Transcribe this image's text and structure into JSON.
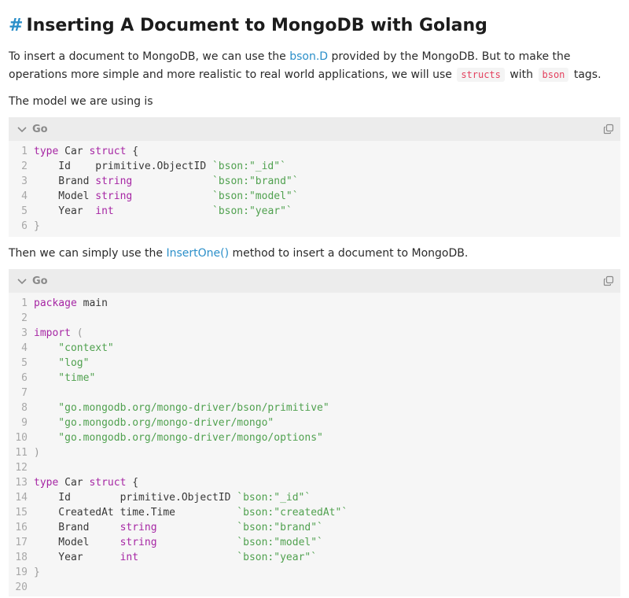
{
  "heading": {
    "hash": "#",
    "text": "Inserting A Document to MongoDB with Golang"
  },
  "intro": {
    "line1_a": "To insert a document to MongoDB, we can use the ",
    "line1_link": "bson.D",
    "line1_b": " provided by the MongoDB. But to make the",
    "line2_a": "operations more simple and more realistic to real world applications, we will use ",
    "code1": "structs",
    "line2_b": " with ",
    "code2": "bson",
    "line2_c": " tags."
  },
  "model_text": "The model we are using is",
  "block1": {
    "lang": "Go",
    "lines": [
      [
        [
          "kw",
          "type"
        ],
        [
          "",
          "Car "
        ],
        [
          "kw",
          "struct"
        ],
        [
          "",
          "{"
        ]
      ],
      [
        [
          "",
          "    Id    primitive.ObjectID "
        ],
        [
          "str",
          "`bson:\"_id\"`"
        ]
      ],
      [
        [
          "",
          "    Brand "
        ],
        [
          "kw",
          "string"
        ],
        [
          "",
          "             "
        ],
        [
          "str",
          "`bson:\"brand\"`"
        ]
      ],
      [
        [
          "",
          "    Model "
        ],
        [
          "kw",
          "string"
        ],
        [
          "",
          "             "
        ],
        [
          "str",
          "`bson:\"model\"`"
        ]
      ],
      [
        [
          "",
          "    Year  "
        ],
        [
          "kw",
          "int"
        ],
        [
          "",
          "                "
        ],
        [
          "str",
          "`bson:\"year\"`"
        ]
      ],
      [
        [
          "pn",
          "}"
        ]
      ]
    ]
  },
  "then_text": {
    "a": "Then we can simply use the ",
    "link": "InsertOne()",
    "b": " method to insert a document to MongoDB."
  },
  "block2": {
    "lang": "Go",
    "lines": [
      [
        [
          "kw",
          "package"
        ],
        [
          "",
          "main"
        ]
      ],
      [],
      [
        [
          "kw",
          "import"
        ],
        [
          "pn",
          " ("
        ]
      ],
      [
        [
          "str",
          "    \"context\""
        ]
      ],
      [
        [
          "str",
          "    \"log\""
        ]
      ],
      [
        [
          "str",
          "    \"time\""
        ]
      ],
      [],
      [
        [
          "str",
          "    \"go.mongodb.org/mongo-driver/bson/primitive\""
        ]
      ],
      [
        [
          "str",
          "    \"go.mongodb.org/mongo-driver/mongo\""
        ]
      ],
      [
        [
          "str",
          "    \"go.mongodb.org/mongo-driver/mongo/options\""
        ]
      ],
      [
        [
          "pn",
          ")"
        ]
      ],
      [],
      [
        [
          "kw",
          "type"
        ],
        [
          "",
          "Car "
        ],
        [
          "kw",
          "struct"
        ],
        [
          "",
          "{"
        ]
      ],
      [
        [
          "",
          "    Id        primitive.ObjectID "
        ],
        [
          "str",
          "`bson:\"_id\"`"
        ]
      ],
      [
        [
          "",
          "    CreatedAt time.Time          "
        ],
        [
          "str",
          "`bson:\"createdAt\"`"
        ]
      ],
      [
        [
          "",
          "    Brand     "
        ],
        [
          "kw",
          "string"
        ],
        [
          "",
          "             "
        ],
        [
          "str",
          "`bson:\"brand\"`"
        ]
      ],
      [
        [
          "",
          "    Model     "
        ],
        [
          "kw",
          "string"
        ],
        [
          "",
          "             "
        ],
        [
          "str",
          "`bson:\"model\"`"
        ]
      ],
      [
        [
          "",
          "    Year      "
        ],
        [
          "kw",
          "int"
        ],
        [
          "",
          "                "
        ],
        [
          "str",
          "`bson:\"year\"`"
        ]
      ],
      [
        [
          "pn",
          "}"
        ]
      ],
      []
    ]
  },
  "icons": {
    "collapse": "chevron-down-icon",
    "copy": "copy-icon"
  },
  "colors": {
    "link": "#2b8fc9",
    "keyword": "#a626a4",
    "string": "#50a14f",
    "inline_code": "#e4405e"
  }
}
